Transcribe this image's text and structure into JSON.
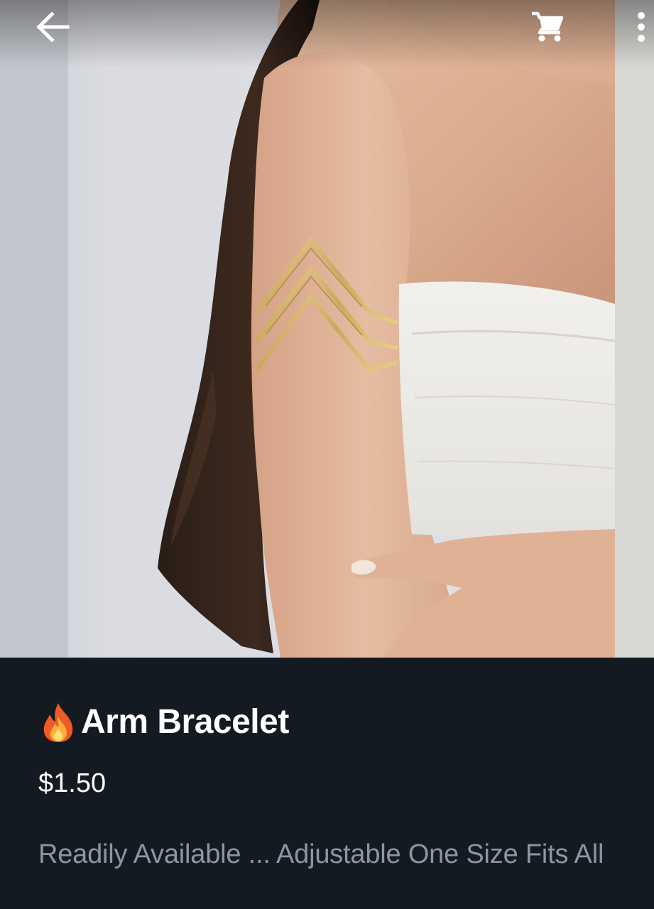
{
  "app_bar": {
    "back_icon": "arrow-left-icon",
    "cart_icon": "shopping-cart-icon",
    "menu_icon": "more-vertical-icon"
  },
  "product": {
    "title_icon": "fire-emoji-icon",
    "title": "Arm Bracelet",
    "price": "$1.50",
    "description": "Readily Available ... Adjustable One Size Fits All"
  },
  "colors": {
    "panel_background": "#141a21",
    "title_text": "#ffffff",
    "description_text": "#8d96a0"
  }
}
